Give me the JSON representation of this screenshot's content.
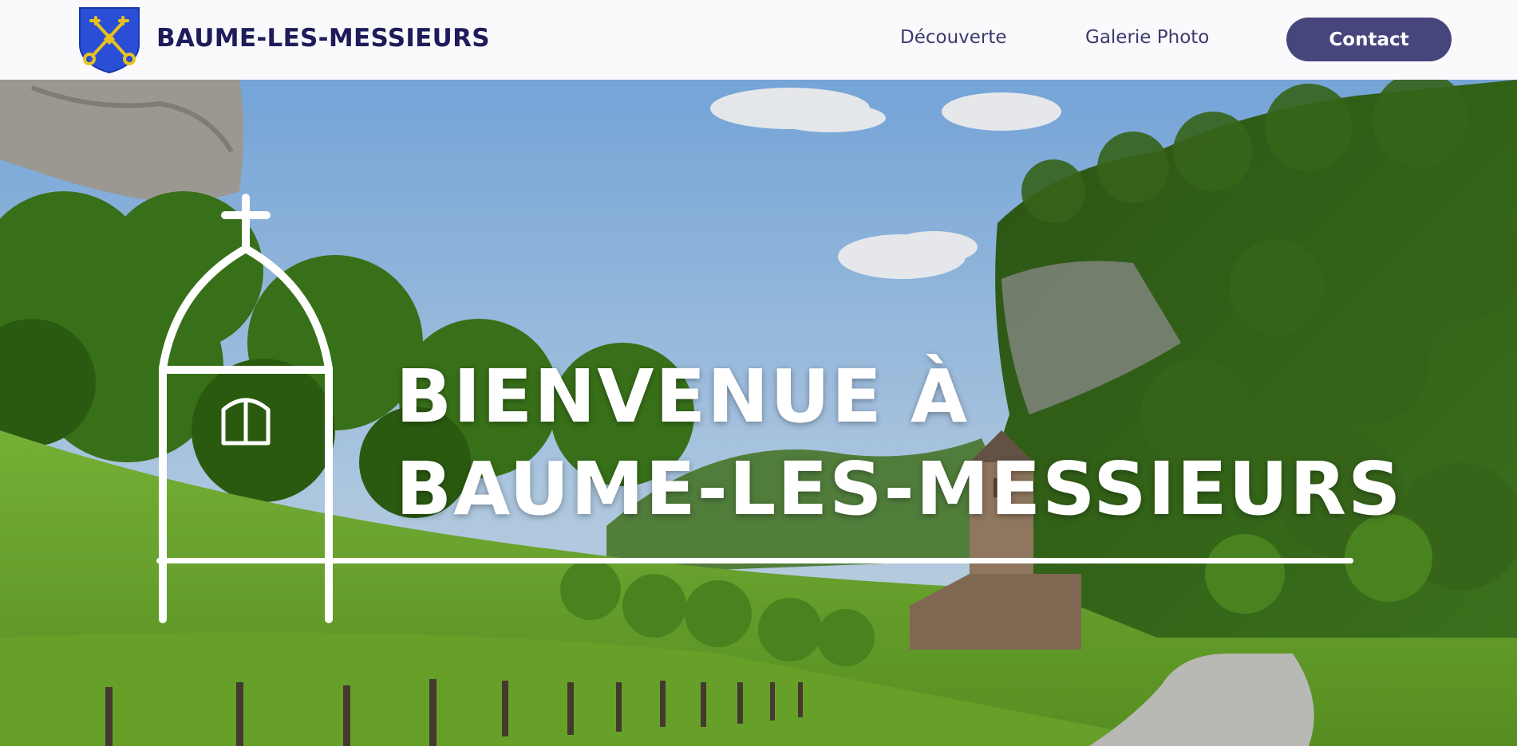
{
  "header": {
    "logo_icon": "crossed-keys-shield-icon",
    "site_name": "BAUME-LES-MESSIEURS",
    "nav": {
      "decouverte": "Découverte",
      "galerie": "Galerie Photo"
    },
    "contact_label": "Contact"
  },
  "hero": {
    "title_line1": "BIENVENUE À",
    "title_line2": "BAUME-LES-MESSIEURS",
    "church_icon": "church-outline-icon",
    "background": "valley-village-photo"
  },
  "colors": {
    "brand_navy": "#1e1c5a",
    "button": "#47467c",
    "header_bg": "#fafafc",
    "shield_blue": "#2a4fd6",
    "shield_gold": "#e8c21a"
  }
}
